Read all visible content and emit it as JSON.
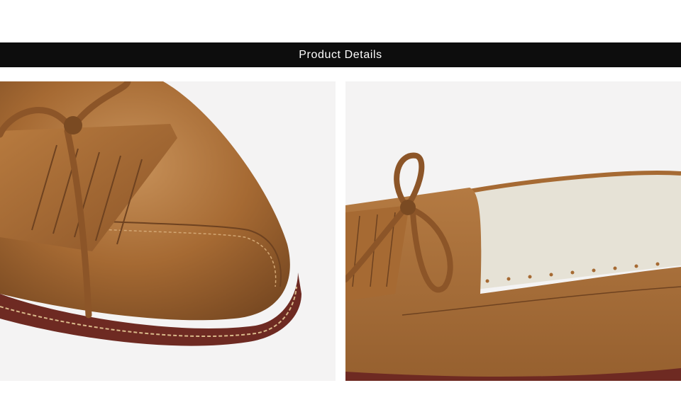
{
  "header": {
    "title": "Product Details"
  },
  "photos": [
    {
      "name": "shoe-toe-closeup",
      "icon": "shoe-toe-photo"
    },
    {
      "name": "shoe-bow-insole-closeup",
      "icon": "shoe-bow-photo"
    }
  ],
  "colors": {
    "leather": "#a66a33",
    "leather_dark": "#7a4a22",
    "sole": "#6e2a22",
    "insole": "#e6e2d6",
    "background": "#f4f3f3",
    "header_bg": "#0d0d0d",
    "header_text": "#ffffff"
  }
}
